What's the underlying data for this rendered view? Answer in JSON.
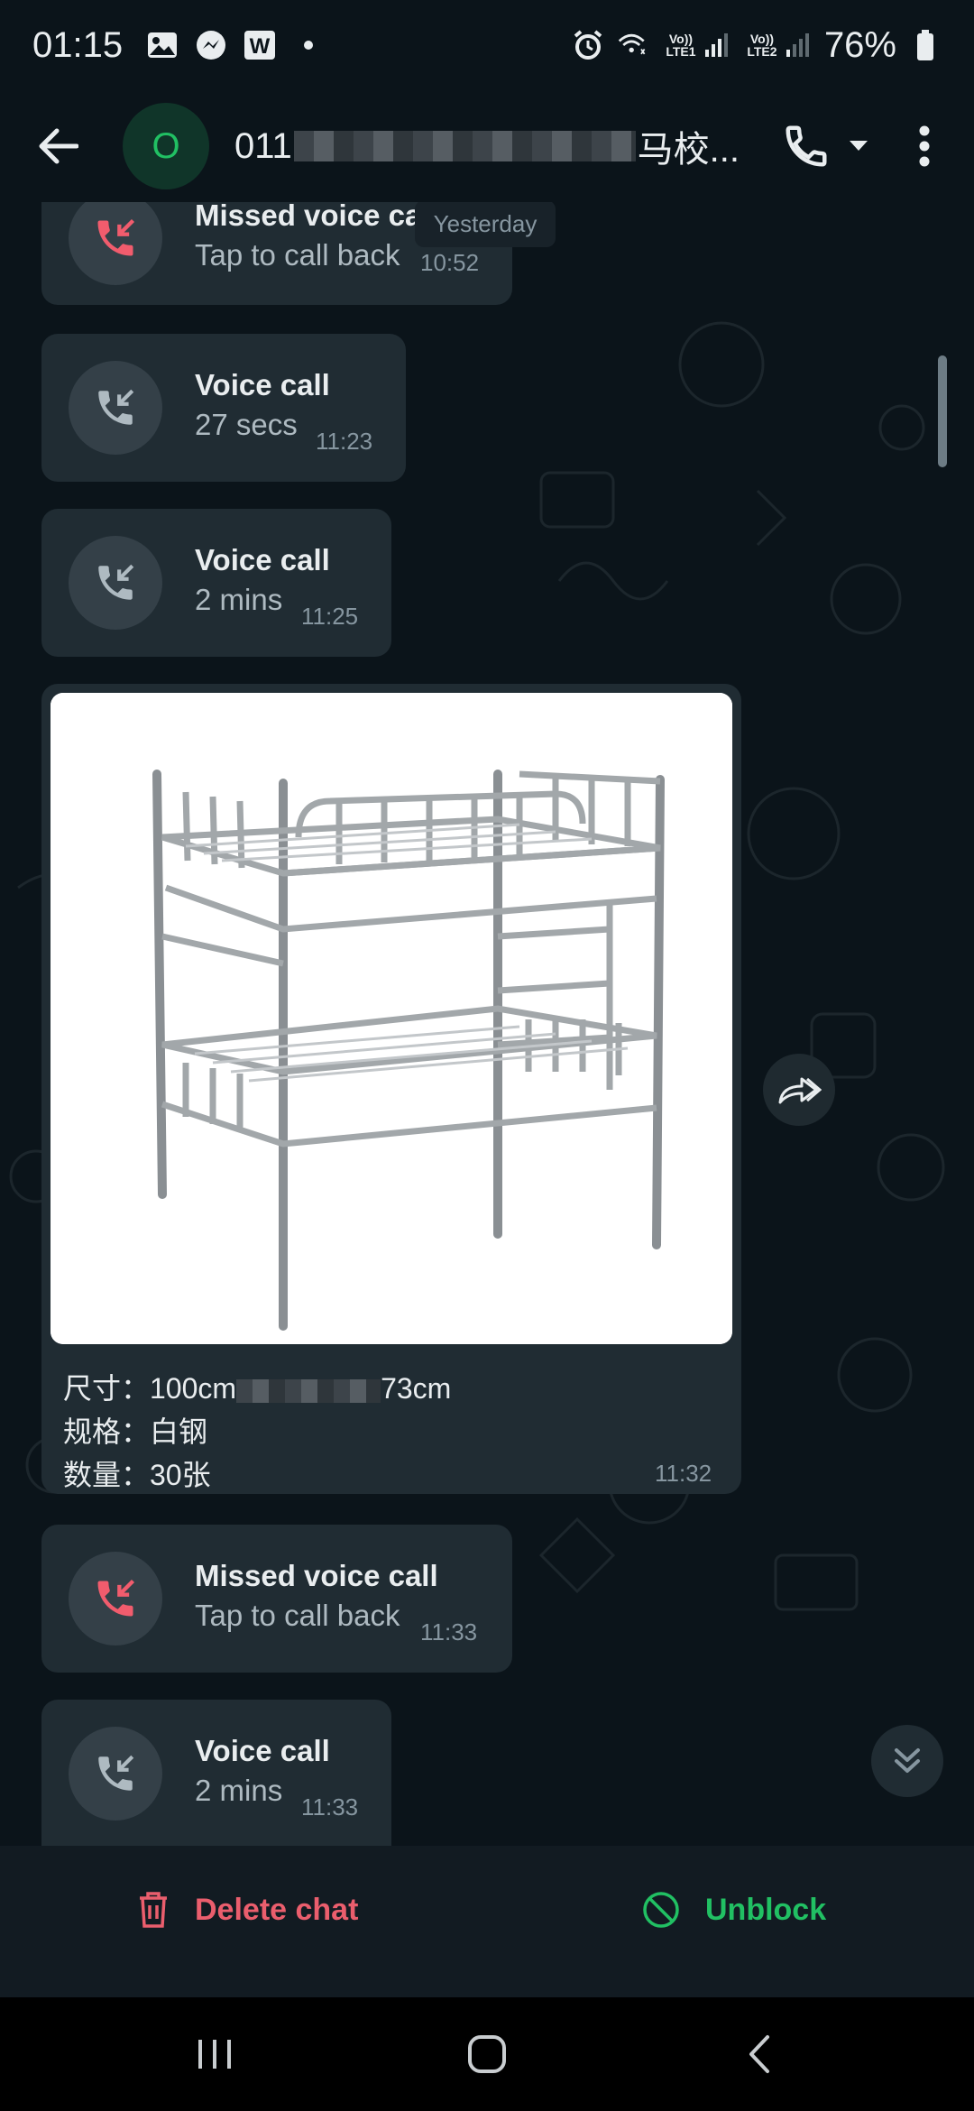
{
  "status_bar": {
    "time": "01:15",
    "battery": "76%",
    "lte1_label": "Vo)) LTE1",
    "lte2_label": "Vo)) LTE2",
    "icons": [
      "image-icon",
      "messenger-icon",
      "w-app-icon",
      "dot-icon",
      "alarm-icon",
      "wifi-call-icon",
      "signal-icon",
      "battery-icon"
    ]
  },
  "header": {
    "avatar_letter": "O",
    "title_prefix": "011",
    "title_suffix": "马校...",
    "icons": [
      "back-arrow-icon",
      "phone-icon",
      "dropdown-icon",
      "more-vert-icon"
    ]
  },
  "chat": {
    "date_chip": "Yesterday",
    "messages": [
      {
        "type": "missed_call",
        "title": "Missed voice call",
        "subtitle": "Tap to call back",
        "time": "10:52"
      },
      {
        "type": "voice_call",
        "title": "Voice call",
        "subtitle": "27 secs",
        "time": "11:23"
      },
      {
        "type": "voice_call",
        "title": "Voice call",
        "subtitle": "2 mins",
        "time": "11:25"
      },
      {
        "type": "image",
        "caption_lines": [
          "尺寸：100cm",
          "73cm",
          "规格：白钢",
          "数量：30张"
        ],
        "time": "11:32"
      },
      {
        "type": "missed_call",
        "title": "Missed voice call",
        "subtitle": "Tap to call back",
        "time": "11:33"
      },
      {
        "type": "voice_call",
        "title": "Voice call",
        "subtitle": "2 mins",
        "time": "11:33"
      }
    ]
  },
  "actions": {
    "delete_label": "Delete chat",
    "unblock_label": "Unblock"
  },
  "colors": {
    "background": "#0b141a",
    "bubble": "#202c33",
    "missed": "#f15c6d",
    "accent_green": "#21c063",
    "delete_red": "#ea5e6d"
  }
}
